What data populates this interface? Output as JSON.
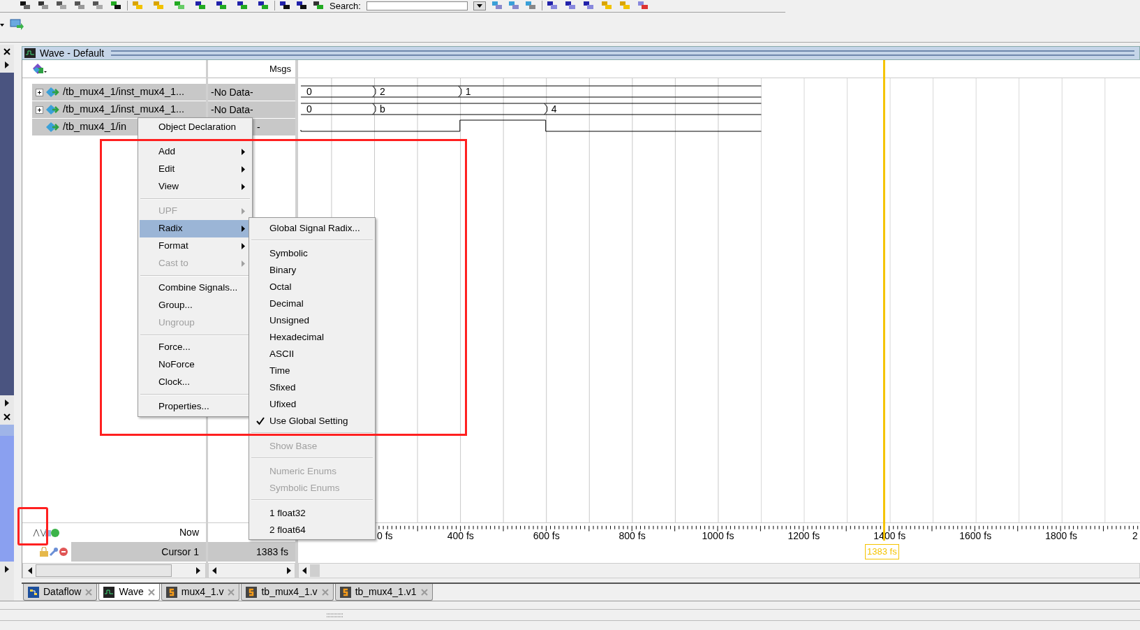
{
  "toolbar": {
    "search_label": "Search:"
  },
  "wave_window": {
    "title": "Wave - Default",
    "msgs_header": "Msgs",
    "signals": [
      {
        "name": "/tb_mux4_1/inst_mux4_1...",
        "value": "-No Data-",
        "expandable": true,
        "kind": "bus",
        "segments": [
          {
            "value": "0"
          },
          {
            "value": "2"
          },
          {
            "value": "1"
          }
        ]
      },
      {
        "name": "/tb_mux4_1/inst_mux4_1...",
        "value": "-No Data-",
        "expandable": true,
        "kind": "bus",
        "segments": [
          {
            "value": "0"
          },
          {
            "value": "b"
          },
          {
            "value": "4"
          }
        ]
      },
      {
        "name": "/tb_mux4_1/in",
        "value": "-",
        "expandable": false,
        "kind": "bit",
        "segments": [
          {
            "high": false
          },
          {
            "high": true
          },
          {
            "high": false
          }
        ]
      }
    ],
    "now_label": "Now",
    "cursor": {
      "name": "Cursor 1",
      "value": "1383 fs",
      "marker": "1383 fs"
    },
    "time_labels": [
      "0 fs",
      "400 fs",
      "600 fs",
      "800 fs",
      "1000 fs",
      "1200 fs",
      "1400 fs",
      "1600 fs",
      "1800 fs",
      "2"
    ]
  },
  "context_menu": {
    "items": [
      {
        "kind": "item",
        "label": "Object Declaration",
        "submenu": false,
        "disabled": false,
        "selected": false
      },
      {
        "kind": "separator"
      },
      {
        "kind": "item",
        "label": "Add",
        "submenu": true,
        "disabled": false,
        "selected": false
      },
      {
        "kind": "item",
        "label": "Edit",
        "submenu": true,
        "disabled": false,
        "selected": false
      },
      {
        "kind": "item",
        "label": "View",
        "submenu": true,
        "disabled": false,
        "selected": false
      },
      {
        "kind": "separator"
      },
      {
        "kind": "item",
        "label": "UPF",
        "submenu": true,
        "disabled": true,
        "selected": false
      },
      {
        "kind": "item",
        "label": "Radix",
        "submenu": true,
        "disabled": false,
        "selected": true
      },
      {
        "kind": "item",
        "label": "Format",
        "submenu": true,
        "disabled": false,
        "selected": false
      },
      {
        "kind": "item",
        "label": "Cast to",
        "submenu": true,
        "disabled": true,
        "selected": false
      },
      {
        "kind": "separator"
      },
      {
        "kind": "item",
        "label": "Combine Signals...",
        "submenu": false,
        "disabled": false,
        "selected": false
      },
      {
        "kind": "item",
        "label": "Group...",
        "submenu": false,
        "disabled": false,
        "selected": false
      },
      {
        "kind": "item",
        "label": "Ungroup",
        "submenu": false,
        "disabled": true,
        "selected": false
      },
      {
        "kind": "separator"
      },
      {
        "kind": "item",
        "label": "Force...",
        "submenu": false,
        "disabled": false,
        "selected": false
      },
      {
        "kind": "item",
        "label": "NoForce",
        "submenu": false,
        "disabled": false,
        "selected": false
      },
      {
        "kind": "item",
        "label": "Clock...",
        "submenu": false,
        "disabled": false,
        "selected": false
      },
      {
        "kind": "separator"
      },
      {
        "kind": "item",
        "label": "Properties...",
        "submenu": false,
        "disabled": false,
        "selected": false
      }
    ]
  },
  "radix_submenu": {
    "items": [
      {
        "kind": "item",
        "label": "Global Signal Radix...",
        "checked": false,
        "disabled": false,
        "selected": false
      },
      {
        "kind": "separator"
      },
      {
        "kind": "item",
        "label": "Symbolic",
        "checked": false,
        "disabled": false,
        "selected": false
      },
      {
        "kind": "item",
        "label": "Binary",
        "checked": false,
        "disabled": false,
        "selected": false
      },
      {
        "kind": "item",
        "label": "Octal",
        "checked": false,
        "disabled": false,
        "selected": false
      },
      {
        "kind": "item",
        "label": "Decimal",
        "checked": false,
        "disabled": false,
        "selected": false
      },
      {
        "kind": "item",
        "label": "Unsigned",
        "checked": false,
        "disabled": false,
        "selected": false
      },
      {
        "kind": "item",
        "label": "Hexadecimal",
        "checked": false,
        "disabled": false,
        "selected": false
      },
      {
        "kind": "item",
        "label": "ASCII",
        "checked": false,
        "disabled": false,
        "selected": false
      },
      {
        "kind": "item",
        "label": "Time",
        "checked": false,
        "disabled": false,
        "selected": false
      },
      {
        "kind": "item",
        "label": "Sfixed",
        "checked": false,
        "disabled": false,
        "selected": false
      },
      {
        "kind": "item",
        "label": "Ufixed",
        "checked": false,
        "disabled": false,
        "selected": false
      },
      {
        "kind": "item",
        "label": "Use Global Setting",
        "checked": true,
        "disabled": false,
        "selected": false
      },
      {
        "kind": "separator"
      },
      {
        "kind": "item",
        "label": "Show Base",
        "checked": false,
        "disabled": true,
        "selected": false
      },
      {
        "kind": "separator"
      },
      {
        "kind": "item",
        "label": "Numeric Enums",
        "checked": false,
        "disabled": true,
        "selected": false
      },
      {
        "kind": "item",
        "label": "Symbolic Enums",
        "checked": false,
        "disabled": true,
        "selected": false
      },
      {
        "kind": "separator"
      },
      {
        "kind": "item",
        "label": "1 float32",
        "checked": false,
        "disabled": false,
        "selected": false
      },
      {
        "kind": "item",
        "label": "2 float64",
        "checked": false,
        "disabled": false,
        "selected": false
      }
    ]
  },
  "tabs": [
    {
      "label": "Dataflow",
      "kind": "dataflow",
      "selected": false
    },
    {
      "label": "Wave",
      "kind": "wave",
      "selected": true
    },
    {
      "label": "mux4_1.v",
      "kind": "source",
      "selected": false
    },
    {
      "label": "tb_mux4_1.v",
      "kind": "source",
      "selected": false
    },
    {
      "label": "tb_mux4_1.v1",
      "kind": "source",
      "selected": false
    }
  ]
}
